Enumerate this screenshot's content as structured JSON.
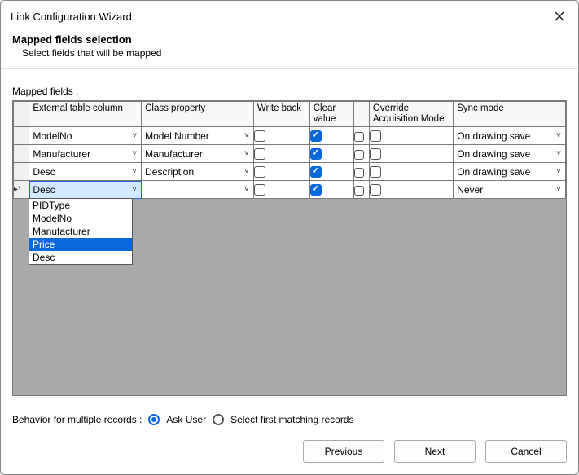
{
  "title": "Link Configuration Wizard",
  "heading": "Mapped fields selection",
  "subheading": "Select fields that will be mapped",
  "mapped_label": "Mapped fields :",
  "columns": {
    "ext": "External table column",
    "class": "Class property",
    "write": "Write back",
    "clear": "Clear value",
    "narrow": "",
    "over": "Override Acquisition Mode",
    "sync": "Sync mode"
  },
  "rows": [
    {
      "marker": "",
      "ext": "ModelNo",
      "class": "Model Number",
      "write": false,
      "clear": true,
      "narrow": false,
      "over": false,
      "sync": "On drawing save"
    },
    {
      "marker": "",
      "ext": "Manufacturer",
      "class": "Manufacturer",
      "write": false,
      "clear": true,
      "narrow": false,
      "over": false,
      "sync": "On drawing save"
    },
    {
      "marker": "",
      "ext": "Desc",
      "class": "Description",
      "write": false,
      "clear": true,
      "narrow": false,
      "over": false,
      "sync": "On drawing save"
    },
    {
      "marker": "▸*",
      "ext": "Desc",
      "class": "",
      "write": false,
      "clear": true,
      "narrow": false,
      "over": false,
      "sync": "Never"
    }
  ],
  "dropdown_options": [
    "PIDType",
    "ModelNo",
    "Manufacturer",
    "Price",
    "Desc"
  ],
  "dropdown_highlight": "Price",
  "behavior": {
    "label": "Behavior for multiple records :",
    "opt1": "Ask User",
    "opt2": "Select first matching records",
    "selected": "opt1"
  },
  "buttons": {
    "prev": "Previous",
    "next": "Next",
    "cancel": "Cancel"
  }
}
